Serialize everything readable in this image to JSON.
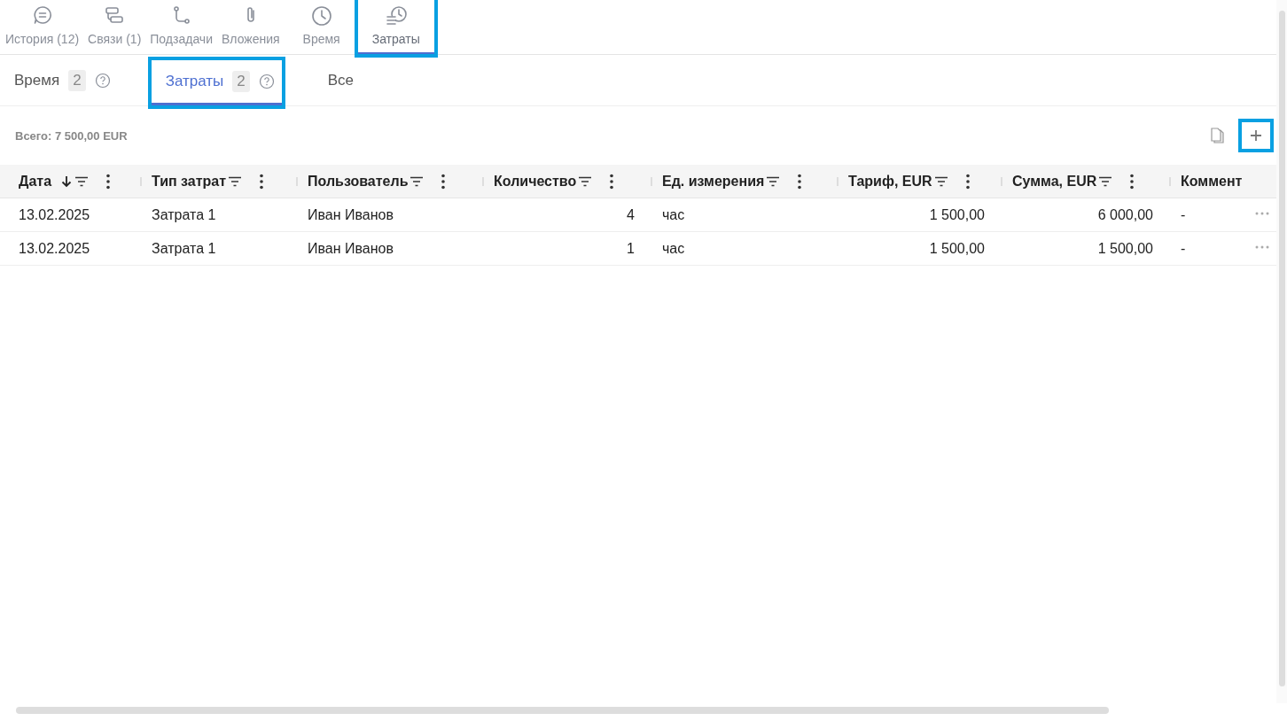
{
  "top_tabs": [
    {
      "label": "История (12)",
      "kind": "history",
      "selected": false,
      "highlighted": false
    },
    {
      "label": "Связи (1)",
      "kind": "links",
      "selected": false,
      "highlighted": false
    },
    {
      "label": "Подзадачи",
      "kind": "subtasks",
      "selected": false,
      "highlighted": false
    },
    {
      "label": "Вложения",
      "kind": "attachments",
      "selected": false,
      "highlighted": false
    },
    {
      "label": "Время",
      "kind": "time",
      "selected": false,
      "highlighted": false
    },
    {
      "label": "Затраты",
      "kind": "costs",
      "selected": true,
      "highlighted": true
    }
  ],
  "sub_tabs": [
    {
      "label": "Время",
      "count": "2",
      "help": true,
      "selected": false,
      "highlighted": false
    },
    {
      "label": "Затраты",
      "count": "2",
      "help": true,
      "selected": true,
      "highlighted": true
    },
    {
      "label": "Все",
      "help": false,
      "selected": false,
      "highlighted": false
    }
  ],
  "toolbar": {
    "total": "Всего: 7 500,00 EUR",
    "add_highlighted": true
  },
  "table": {
    "columns": [
      {
        "label": "Дата",
        "kind": "text",
        "sorted_descending": true,
        "filter": true
      },
      {
        "label": "Тип затрат",
        "kind": "text",
        "sorted_descending": false,
        "filter": true
      },
      {
        "label": "Пользователь",
        "kind": "text",
        "sorted_descending": false,
        "filter": true
      },
      {
        "label": "Количество",
        "kind": "number",
        "sorted_descending": false,
        "filter": true
      },
      {
        "label": "Ед. измерения",
        "kind": "text",
        "sorted_descending": false,
        "filter": true
      },
      {
        "label": "Тариф, EUR",
        "kind": "number",
        "sorted_descending": false,
        "filter": true
      },
      {
        "label": "Сумма, EUR",
        "kind": "number",
        "sorted_descending": false,
        "filter": true
      },
      {
        "label": "Коммент",
        "kind": "text",
        "sorted_descending": false,
        "filter": false
      }
    ],
    "rows": [
      [
        "13.02.2025",
        "Затрата 1",
        "Иван Иванов",
        "4",
        "час",
        "1 500,00",
        "6 000,00",
        "-"
      ],
      [
        "13.02.2025",
        "Затрата 1",
        "Иван Иванов",
        "1",
        "час",
        "1 500,00",
        "1 500,00",
        "-"
      ]
    ]
  }
}
